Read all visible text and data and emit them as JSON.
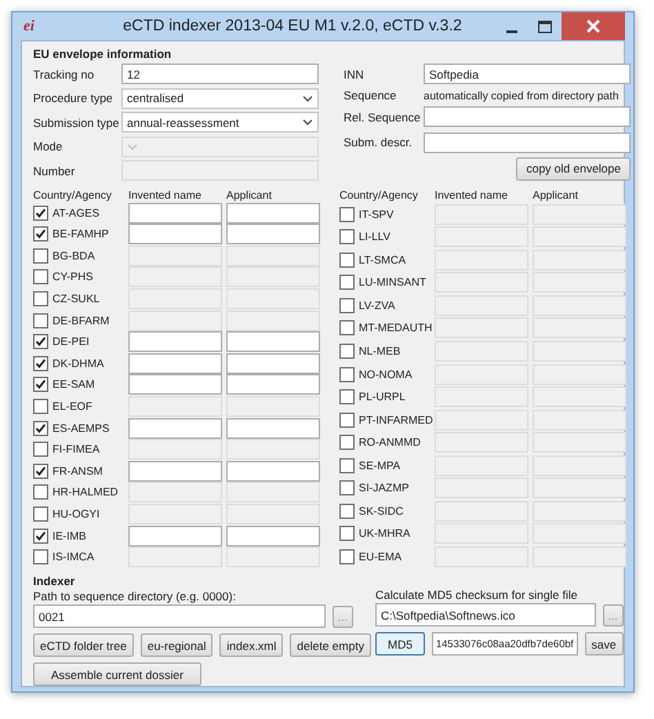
{
  "window": {
    "title": "eCTD indexer 2013-04 EU M1 v.2.0, eCTD v.3.2",
    "app_icon": "ei"
  },
  "envelope": {
    "title": "EU envelope information",
    "left_fields": [
      {
        "label": "Tracking no",
        "kind": "text",
        "value": "12",
        "disabled": false
      },
      {
        "label": "Procedure type",
        "kind": "select",
        "value": "centralised",
        "disabled": false
      },
      {
        "label": "Submission type",
        "kind": "select",
        "value": "annual-reassessment",
        "disabled": false
      },
      {
        "label": "Mode",
        "kind": "select",
        "disabled": true
      },
      {
        "label": "Number",
        "kind": "text",
        "disabled": true
      }
    ],
    "right_fields": [
      {
        "label": "INN",
        "kind": "text",
        "value": "Softpedia"
      },
      {
        "label": "Sequence",
        "kind": "note",
        "value": "automatically copied from directory path"
      },
      {
        "label": "Rel. Sequence",
        "kind": "text"
      },
      {
        "label": "Subm. descr.",
        "kind": "text"
      }
    ],
    "copy_button": "copy old envelope"
  },
  "agencies": {
    "columns": [
      "Country/Agency",
      "Invented name",
      "Applicant"
    ],
    "left": [
      {
        "name": "AT-AGES",
        "checked": true
      },
      {
        "name": "BE-FAMHP",
        "checked": true
      },
      {
        "name": "BG-BDA",
        "checked": false
      },
      {
        "name": "CY-PHS",
        "checked": false
      },
      {
        "name": "CZ-SUKL",
        "checked": false
      },
      {
        "name": "DE-BFARM",
        "checked": false
      },
      {
        "name": "DE-PEI",
        "checked": true
      },
      {
        "name": "DK-DHMA",
        "checked": true
      },
      {
        "name": "EE-SAM",
        "checked": true
      },
      {
        "name": "EL-EOF",
        "checked": false
      },
      {
        "name": "ES-AEMPS",
        "checked": true
      },
      {
        "name": "FI-FIMEA",
        "checked": false
      },
      {
        "name": "FR-ANSM",
        "checked": true
      },
      {
        "name": "HR-HALMED",
        "checked": false
      },
      {
        "name": "HU-OGYI",
        "checked": false
      },
      {
        "name": "IE-IMB",
        "checked": true
      },
      {
        "name": "IS-IMCA",
        "checked": false
      }
    ],
    "right_columns": [
      "Country/Agency",
      "Invented name",
      "Applicant"
    ],
    "right": [
      {
        "name": "IT-SPV",
        "checked": false
      },
      {
        "name": "LI-LLV",
        "checked": false
      },
      {
        "name": "LT-SMCA",
        "checked": false
      },
      {
        "name": "LU-MINSANT",
        "checked": false
      },
      {
        "name": "LV-ZVA",
        "checked": false
      },
      {
        "name": "MT-MEDAUTH",
        "checked": false
      },
      {
        "name": "NL-MEB",
        "checked": false
      },
      {
        "name": "NO-NOMA",
        "checked": false
      },
      {
        "name": "PL-URPL",
        "checked": false
      },
      {
        "name": "PT-INFARMED",
        "checked": false
      },
      {
        "name": "RO-ANMMD",
        "checked": false
      },
      {
        "name": "SE-MPA",
        "checked": false
      },
      {
        "name": "SI-JAZMP",
        "checked": false
      },
      {
        "name": "SK-SIDC",
        "checked": false
      },
      {
        "name": "UK-MHRA",
        "checked": false
      },
      {
        "name": "EU-EMA",
        "checked": false
      }
    ]
  },
  "indexer": {
    "title": "Indexer",
    "path_label": "Path to sequence directory (e.g. 0000):",
    "path_value": "0021",
    "browse_button": "...",
    "buttons": [
      "eCTD folder tree",
      "eu-regional",
      "index.xml",
      "delete empty"
    ],
    "assemble_button": "Assemble current dossier",
    "md5_label": "Calculate MD5 checksum for single file",
    "md5_file": "C:\\Softpedia\\Softnews.ico",
    "md5_browse_button": "...",
    "md5_button": "MD5",
    "md5_value": "14533076c08aa20dfb7de60bf",
    "save_button": "save"
  }
}
